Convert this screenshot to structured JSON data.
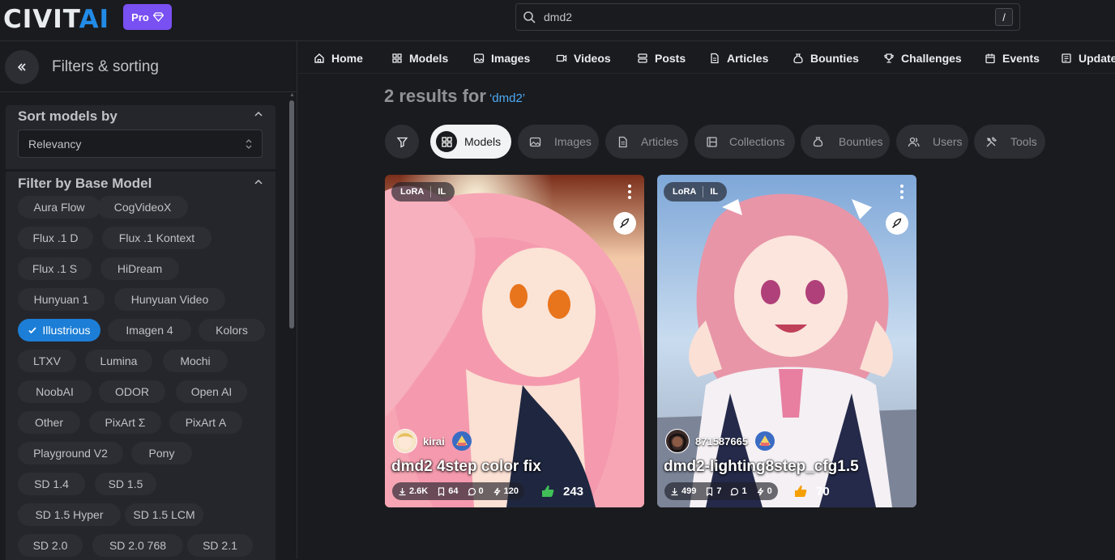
{
  "topbar": {
    "logo_text_a": "CIVIT",
    "logo_text_b": "AI",
    "pro_label": "Pro",
    "search_value": "dmd2",
    "search_shortcut": "/"
  },
  "sidebar": {
    "title": "Filters & sorting",
    "sort_title": "Sort models by",
    "sort_value": "Relevancy",
    "filter_title": "Filter by Base Model",
    "chips": [
      {
        "label": "Aura Flow",
        "active": false
      },
      {
        "label": "CogVideoX",
        "active": false
      },
      {
        "label": "Flux .1 D",
        "active": false
      },
      {
        "label": "Flux .1 Kontext",
        "active": false
      },
      {
        "label": "Flux .1 S",
        "active": false
      },
      {
        "label": "HiDream",
        "active": false
      },
      {
        "label": "Hunyuan 1",
        "active": false
      },
      {
        "label": "Hunyuan Video",
        "active": false
      },
      {
        "label": "Illustrious",
        "active": true
      },
      {
        "label": "Imagen 4",
        "active": false
      },
      {
        "label": "Kolors",
        "active": false
      },
      {
        "label": "LTXV",
        "active": false
      },
      {
        "label": "Lumina",
        "active": false
      },
      {
        "label": "Mochi",
        "active": false
      },
      {
        "label": "NoobAI",
        "active": false
      },
      {
        "label": "ODOR",
        "active": false
      },
      {
        "label": "Open AI",
        "active": false
      },
      {
        "label": "Other",
        "active": false
      },
      {
        "label": "PixArt Σ",
        "active": false
      },
      {
        "label": "PixArt Α",
        "active": false
      },
      {
        "label": "Playground V2",
        "active": false
      },
      {
        "label": "Pony",
        "active": false
      },
      {
        "label": "SD 1.4",
        "active": false
      },
      {
        "label": "SD 1.5",
        "active": false
      },
      {
        "label": "SD 1.5 Hyper",
        "active": false
      },
      {
        "label": "SD 1.5 LCM",
        "active": false
      },
      {
        "label": "SD 2.0",
        "active": false
      },
      {
        "label": "SD 2.0 768",
        "active": false
      },
      {
        "label": "SD 2.1",
        "active": false
      }
    ]
  },
  "nav": {
    "items": [
      {
        "label": "Home",
        "icon": "home-icon"
      },
      {
        "label": "Models",
        "icon": "grid-icon"
      },
      {
        "label": "Images",
        "icon": "image-icon"
      },
      {
        "label": "Videos",
        "icon": "video-icon"
      },
      {
        "label": "Posts",
        "icon": "posts-icon"
      },
      {
        "label": "Articles",
        "icon": "article-icon"
      },
      {
        "label": "Bounties",
        "icon": "bounty-icon"
      },
      {
        "label": "Challenges",
        "icon": "trophy-icon"
      },
      {
        "label": "Events",
        "icon": "calendar-icon"
      },
      {
        "label": "Updates",
        "icon": "updates-icon"
      }
    ]
  },
  "results": {
    "count_text": "2 results for",
    "query_text": "‘dmd2’"
  },
  "tabs": [
    {
      "label": "Models",
      "icon": "grid-icon",
      "active": true
    },
    {
      "label": "Images",
      "icon": "image-icon",
      "active": false
    },
    {
      "label": "Articles",
      "icon": "article-icon",
      "active": false
    },
    {
      "label": "Collections",
      "icon": "collection-icon",
      "active": false
    },
    {
      "label": "Bounties",
      "icon": "bounty-icon",
      "active": false
    },
    {
      "label": "Users",
      "icon": "users-icon",
      "active": false
    },
    {
      "label": "Tools",
      "icon": "tools-icon",
      "active": false
    }
  ],
  "cards": [
    {
      "type": "LoRA",
      "base": "IL",
      "creator": "kirai",
      "title": "dmd2 4step color fix",
      "downloads": "2.6K",
      "collected": "64",
      "comments": "0",
      "buzz": "120",
      "likes": "243"
    },
    {
      "type": "LoRA",
      "base": "IL",
      "creator": "871587665",
      "title": "dmd2-lighting8step_cfg1.5",
      "downloads": "499",
      "collected": "7",
      "comments": "1",
      "buzz": "0",
      "likes": "70"
    }
  ],
  "colors": {
    "background": "#1a1b1e",
    "panel": "#25262b",
    "accent": "#228be6",
    "pro": "#7950f2",
    "active_chip": "#1c7ed6"
  }
}
